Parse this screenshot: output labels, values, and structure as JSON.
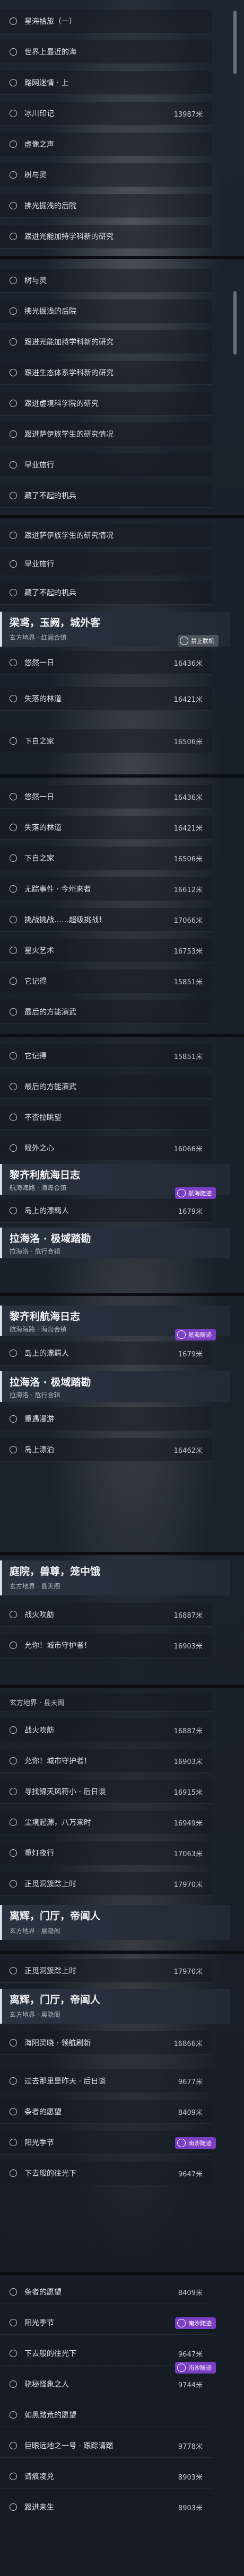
{
  "strips": [
    {
      "rows": [
        {
          "label": "星海拾旅（一）",
          "distance": ""
        },
        {
          "label": "世界上最近的海",
          "distance": ""
        },
        {
          "label": "路网迷情 · 上",
          "distance": ""
        },
        {
          "label": "冰川印记",
          "distance": "13987米"
        },
        {
          "label": "虚像之声",
          "distance": ""
        },
        {
          "label": "树与灵",
          "distance": ""
        },
        {
          "label": "拂光掘浅的后院",
          "distance": ""
        },
        {
          "label": "跟进光能加持学科新的研究",
          "distance": ""
        }
      ]
    },
    {
      "rows": [
        {
          "label": "树与灵",
          "distance": ""
        },
        {
          "label": "拂光掘浅的后院",
          "distance": ""
        },
        {
          "label": "跟进光能加持学科新的研究",
          "distance": ""
        },
        {
          "label": "跟进生态体系学科新的研究",
          "distance": ""
        },
        {
          "label": "跟进虚境科学院的研究",
          "distance": ""
        },
        {
          "label": "跟进萨伊族学生的研究情况",
          "distance": ""
        },
        {
          "label": "早业旅行",
          "distance": ""
        },
        {
          "label": "藏了不起的机兵",
          "distance": ""
        }
      ]
    },
    {
      "top_rows": [
        {
          "label": "跟进萨伊族学生的研究情况",
          "distance": ""
        },
        {
          "label": "早业旅行",
          "distance": ""
        },
        {
          "label": "藏了不起的机兵",
          "distance": ""
        }
      ],
      "header": {
        "title": "梁鸢，玉阙，城外客",
        "subtitle": "玄方地界 · 红阙合镇",
        "badge": "禁止联机"
      },
      "rows": [
        {
          "label": "悠然一日",
          "distance": "16436米"
        },
        {
          "label": "失落的林道",
          "distance": "16421米"
        },
        {
          "label": "下自之家",
          "distance": "16506米"
        }
      ]
    },
    {
      "rows": [
        {
          "label": "悠然一日",
          "distance": "16436米"
        },
        {
          "label": "失落的林道",
          "distance": "16421米"
        },
        {
          "label": "下自之家",
          "distance": "16506米"
        },
        {
          "label": "无踪事件 · 今州来者",
          "distance": "16612米"
        },
        {
          "label": "挑战挑战……超级挑战！",
          "distance": "17066米"
        },
        {
          "label": "星火艺术",
          "distance": "16753米"
        },
        {
          "label": "它记得",
          "distance": "15851米"
        },
        {
          "label": "最后的方能演武",
          "distance": ""
        }
      ]
    },
    {
      "rows": [
        {
          "label": "它记得",
          "distance": "15851米"
        },
        {
          "label": "最后的方能演武",
          "distance": ""
        },
        {
          "label": "不否拉眺望",
          "distance": ""
        },
        {
          "label": "眼外之心",
          "distance": "16066米"
        }
      ],
      "header": {
        "title": "黎齐利航海日志",
        "subtitle": "航海海路 · 海岛合镇",
        "badge": "航海随迹"
      },
      "after_rows": [
        {
          "label": "岛上的漂羁人",
          "distance": "1679米"
        }
      ],
      "header2": {
        "title": "拉海洛 · 极域踏勘",
        "subtitle": "拉海洛 · 危行合辑"
      }
    },
    {
      "header": {
        "title": "黎齐利航海日志",
        "subtitle": "航海海路 · 海岛合镇",
        "badge": "航海随迹"
      },
      "after_rows": [
        {
          "label": "岛上的漂羁人",
          "distance": "1679米"
        }
      ],
      "header2": {
        "title": "拉海洛 · 极域踏勘",
        "subtitle": "拉海洛 · 危行合辑"
      },
      "rows": [
        {
          "label": "重遇漫游",
          "distance": ""
        },
        {
          "label": "岛上漂泊",
          "distance": "16462米"
        }
      ]
    },
    {
      "header": {
        "title": "庭院，兽尊，笼中饿",
        "subtitle": "玄方地界 · 县天阁",
        "badge": ""
      },
      "rows": [
        {
          "label": "战火吹舫",
          "distance": "16887米"
        },
        {
          "label": "允你！城市守护者！",
          "distance": "16903米"
        }
      ]
    },
    {
      "title_line": "玄方地界 · 县天阁",
      "rows": [
        {
          "label": "战火吹舫",
          "distance": "16887米"
        },
        {
          "label": "允你！城市守护者！",
          "distance": "16903米"
        },
        {
          "label": "寻找锦天风符小 · 后日谈",
          "distance": "16915米"
        },
        {
          "label": "尘境起源，八万来时",
          "distance": "16949米"
        },
        {
          "label": "重灯夜行",
          "distance": "17063米"
        },
        {
          "label": "正觅洞簇踪上时",
          "distance": "17970米"
        }
      ],
      "header": {
        "title": "离辉，门厅，帝阊人",
        "subtitle": "玄方地界 · 晨隐阁",
        "badge": ""
      }
    },
    {
      "rows": [
        {
          "label": "正觅洞簇踪上时",
          "distance": "17970米"
        }
      ],
      "header": {
        "title": "离辉，门厅，帝阊人",
        "subtitle": "玄方地界 · 晨隐阁",
        "badge": ""
      },
      "after_rows": [
        {
          "label": "海阳灵晓 · 领航刷新",
          "distance": "16866米"
        },
        {
          "label": "过去那里是昨天 · 后日谈",
          "distance": "9677米"
        },
        {
          "label": "条者的愿望",
          "distance": "8409米"
        },
        {
          "label": "阳光季节",
          "distance": "",
          "badge": "南沙随迹"
        },
        {
          "label": "下去般的往光下",
          "distance": "9647米"
        }
      ]
    },
    {
      "rows": [
        {
          "label": "条者的愿望",
          "distance": "8409米"
        },
        {
          "label": "阳光季节",
          "distance": "",
          "badge": "南沙随迹"
        },
        {
          "label": "下去般的往光下",
          "distance": "9647米"
        },
        {
          "label": "骁秘怪象之人",
          "distance": "9744米",
          "badge": "南沙随迹"
        },
        {
          "label": "如黑踏荒的愿望",
          "distance": ""
        },
        {
          "label": "巨眼远地之一号 · 跟踪请踏",
          "distance": "9778米"
        },
        {
          "label": "请痕凌兑",
          "distance": "8903米"
        },
        {
          "label": "跟进来生",
          "distance": "8903米"
        }
      ]
    }
  ]
}
